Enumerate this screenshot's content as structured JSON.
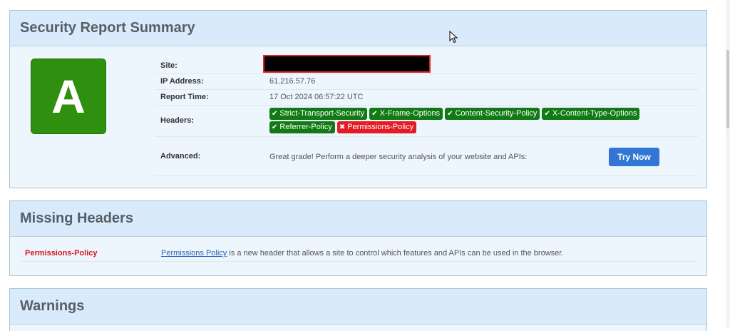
{
  "summary": {
    "title": "Security Report Summary",
    "grade": "A",
    "rows": {
      "site_label": "Site:",
      "ip_label": "IP Address:",
      "ip_value": "61.216.57.76",
      "time_label": "Report Time:",
      "time_value": "17 Oct 2024 06:57:22 UTC",
      "headers_label": "Headers:",
      "advanced_label": "Advanced:",
      "advanced_text": "Great grade! Perform a deeper security analysis of your website and APIs:",
      "try_now": "Try Now"
    },
    "headers": [
      {
        "name": "Strict-Transport-Security",
        "status": "present",
        "icon": "check-icon"
      },
      {
        "name": "X-Frame-Options",
        "status": "present",
        "icon": "check-icon"
      },
      {
        "name": "Content-Security-Policy",
        "status": "present",
        "icon": "check-icon"
      },
      {
        "name": "X-Content-Type-Options",
        "status": "present",
        "icon": "check-icon"
      },
      {
        "name": "Referrer-Policy",
        "status": "present",
        "icon": "check-icon"
      },
      {
        "name": "Permissions-Policy",
        "status": "missing",
        "icon": "cross-icon"
      }
    ]
  },
  "missing": {
    "title": "Missing Headers",
    "items": [
      {
        "name": "Permissions-Policy",
        "link_text": "Permissions Policy",
        "description": " is a new header that allows a site to control which features and APIs can be used in the browser."
      }
    ]
  },
  "warnings": {
    "title": "Warnings"
  },
  "colors": {
    "grade_green": "#2f8f0e",
    "badge_ok": "#117a14",
    "badge_bad": "#e31b23",
    "button_blue": "#3176d4"
  }
}
